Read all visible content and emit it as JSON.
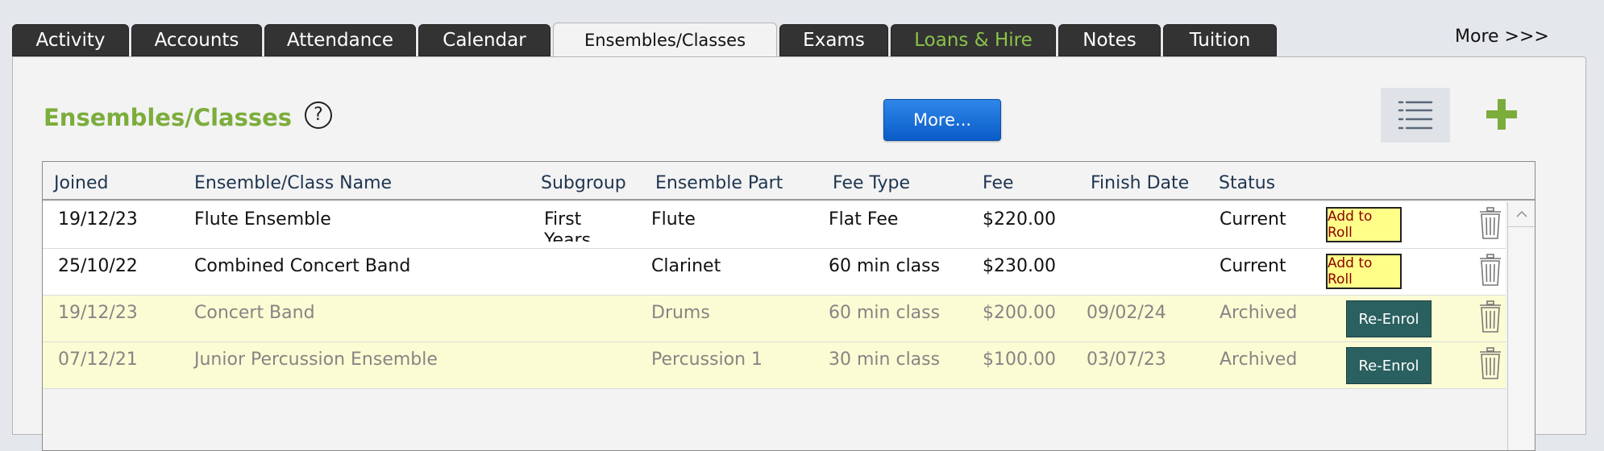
{
  "tabs": [
    {
      "label": "Activity"
    },
    {
      "label": "Accounts"
    },
    {
      "label": "Attendance"
    },
    {
      "label": "Calendar"
    },
    {
      "label": "Ensembles/Classes"
    },
    {
      "label": "Exams"
    },
    {
      "label": "Loans & Hire"
    },
    {
      "label": "Notes"
    },
    {
      "label": "Tuition"
    }
  ],
  "header": {
    "more_link": "More >>>",
    "page_title": "Ensembles/Classes",
    "help_symbol": "?",
    "more_button": "More..."
  },
  "colors": {
    "title_green": "#7cad3c",
    "tab_dark": "#333333",
    "loans_tab_text": "#8bc34a",
    "more_button_blue": "#0a5cc9",
    "roll_button_yellow": "#fffe88",
    "reenrol_button_teal": "#2b6060",
    "archived_row": "#fcfcd4"
  },
  "table": {
    "columns": {
      "joined": "Joined",
      "name": "Ensemble/Class Name",
      "subgroup": "Subgroup",
      "part": "Ensemble Part",
      "fee_type": "Fee Type",
      "fee": "Fee",
      "finish_date": "Finish Date",
      "status": "Status"
    },
    "rows": [
      {
        "joined": "19/12/23",
        "name": "Flute Ensemble",
        "subgroup": "First Years",
        "part": "Flute",
        "fee_type": "Flat Fee",
        "fee": "$220.00",
        "finish_date": "",
        "status": "Current",
        "action": "Add to Roll"
      },
      {
        "joined": "25/10/22",
        "name": "Combined Concert Band",
        "subgroup": "",
        "part": "Clarinet",
        "fee_type": "60 min class",
        "fee": "$230.00",
        "finish_date": "",
        "status": "Current",
        "action": "Add to Roll"
      },
      {
        "joined": "19/12/23",
        "name": "Concert Band",
        "subgroup": "",
        "part": "Drums",
        "fee_type": "60 min class",
        "fee": "$200.00",
        "finish_date": "09/02/24",
        "status": "Archived",
        "action": "Re-Enrol"
      },
      {
        "joined": "07/12/21",
        "name": "Junior Percussion Ensemble",
        "subgroup": "",
        "part": "Percussion 1",
        "fee_type": "30 min class",
        "fee": "$100.00",
        "finish_date": "03/07/23",
        "status": "Archived",
        "action": "Re-Enrol"
      }
    ]
  }
}
